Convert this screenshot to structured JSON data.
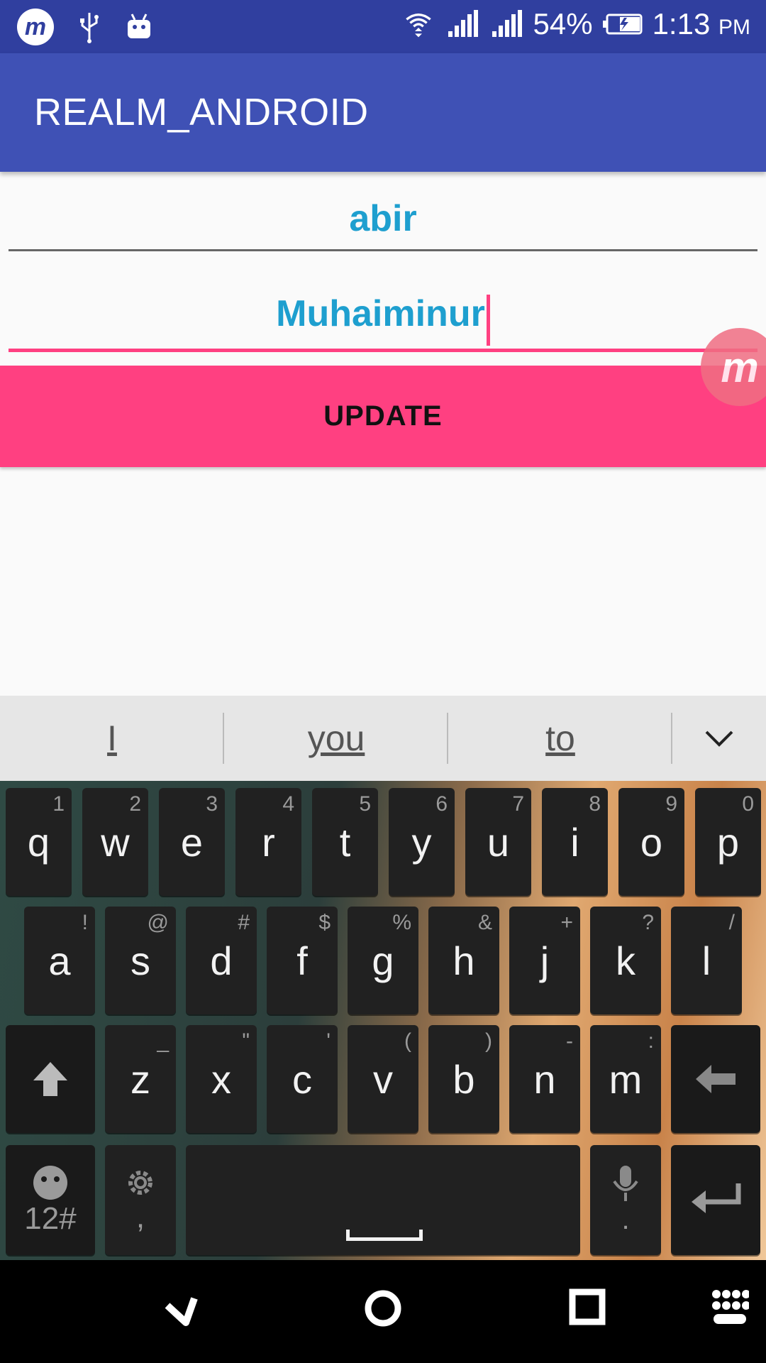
{
  "status_bar": {
    "battery_percent": "54%",
    "time": "1:13",
    "ampm": "PM",
    "icons": [
      "m-app-icon",
      "usb-icon",
      "android-debug-icon",
      "wifi-icon",
      "signal-icon-1",
      "signal-icon-2",
      "battery-charging-icon"
    ]
  },
  "app_bar": {
    "title": "REALM_ANDROID"
  },
  "form": {
    "first_name": "abir",
    "last_name": "Muhaiminur",
    "update_label": "UPDATE"
  },
  "suggestions": [
    "I",
    "you",
    "to"
  ],
  "keyboard": {
    "row1": [
      {
        "key": "q",
        "hint": "1"
      },
      {
        "key": "w",
        "hint": "2"
      },
      {
        "key": "e",
        "hint": "3"
      },
      {
        "key": "r",
        "hint": "4"
      },
      {
        "key": "t",
        "hint": "5"
      },
      {
        "key": "y",
        "hint": "6"
      },
      {
        "key": "u",
        "hint": "7"
      },
      {
        "key": "i",
        "hint": "8"
      },
      {
        "key": "o",
        "hint": "9"
      },
      {
        "key": "p",
        "hint": "0"
      }
    ],
    "row2": [
      {
        "key": "a",
        "hint": "!"
      },
      {
        "key": "s",
        "hint": "@"
      },
      {
        "key": "d",
        "hint": "#"
      },
      {
        "key": "f",
        "hint": "$"
      },
      {
        "key": "g",
        "hint": "%"
      },
      {
        "key": "h",
        "hint": "&"
      },
      {
        "key": "j",
        "hint": "+"
      },
      {
        "key": "k",
        "hint": "?"
      },
      {
        "key": "l",
        "hint": "/"
      }
    ],
    "row3": [
      {
        "key": "z",
        "hint": "_"
      },
      {
        "key": "x",
        "hint": "\""
      },
      {
        "key": "c",
        "hint": "'"
      },
      {
        "key": "v",
        "hint": "("
      },
      {
        "key": "b",
        "hint": ")"
      },
      {
        "key": "n",
        "hint": "-"
      },
      {
        "key": "m",
        "hint": ":"
      }
    ],
    "symbols_label": "12#",
    "comma_label": ",",
    "period_label": "."
  },
  "colors": {
    "status_bar": "#303f9f",
    "app_bar": "#3f51b5",
    "accent": "#ff4081",
    "field_text": "#1e9fcf"
  }
}
